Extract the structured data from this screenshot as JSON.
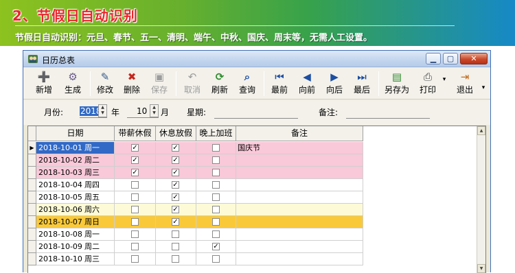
{
  "slide": {
    "title": "2、节假日自动识别",
    "subtitle": "节假日自动识别：元旦、春节、五一、清明、端午、中秋、国庆、周末等，无需人工设置。"
  },
  "window": {
    "title": "日历总表",
    "minimize_glyph": "▁",
    "maximize_glyph": "▢",
    "close_glyph": "✕"
  },
  "toolbar": {
    "new": {
      "label": "新增",
      "glyph": "➕"
    },
    "generate": {
      "label": "生成",
      "glyph": "⚙"
    },
    "edit": {
      "label": "修改",
      "glyph": "✎"
    },
    "delete": {
      "label": "删除",
      "glyph": "✖"
    },
    "save": {
      "label": "保存",
      "glyph": "▣"
    },
    "cancel": {
      "label": "取消",
      "glyph": "↶"
    },
    "refresh": {
      "label": "刷新",
      "glyph": "⟳"
    },
    "query": {
      "label": "查询",
      "glyph": "⌕"
    },
    "first": {
      "label": "最前",
      "glyph": "⏮"
    },
    "prev": {
      "label": "向前",
      "glyph": "◀"
    },
    "next": {
      "label": "向后",
      "glyph": "▶"
    },
    "last": {
      "label": "最后",
      "glyph": "⏭"
    },
    "save_as": {
      "label": "另存为",
      "glyph": "▤"
    },
    "print": {
      "label": "打印",
      "glyph": "⎙"
    },
    "print_dropdown_glyph": "▾",
    "exit": {
      "label": "退出",
      "glyph": "⇥"
    },
    "overflow_glyph": "▾"
  },
  "filter": {
    "month_label": "月份:",
    "year_value": "2018",
    "year_unit": "年",
    "month_value": "10",
    "month_unit": "月",
    "weekday_label": "星期:",
    "remark_label": "备注:",
    "spin_up": "▲",
    "spin_down": "▼"
  },
  "grid": {
    "columns": {
      "date": "日期",
      "paid_leave": "带薪休假",
      "holiday": "休息放假",
      "night_shift": "晚上加班",
      "remark": "备注"
    },
    "current_row_glyph": "▶",
    "check_glyph": "✓",
    "rows": [
      {
        "date": "2018-10-01",
        "weekday": "周一",
        "paid": true,
        "holiday": true,
        "night": false,
        "remark": "国庆节",
        "bg": "#f9c8d9",
        "fg": "#ffffff",
        "sel": true
      },
      {
        "date": "2018-10-02",
        "weekday": "周二",
        "paid": true,
        "holiday": true,
        "night": false,
        "remark": "",
        "bg": "#f9c8d9",
        "fg": "#000000",
        "sel": false
      },
      {
        "date": "2018-10-03",
        "weekday": "周三",
        "paid": true,
        "holiday": true,
        "night": false,
        "remark": "",
        "bg": "#f9c8d9",
        "fg": "#000000",
        "sel": false
      },
      {
        "date": "2018-10-04",
        "weekday": "周四",
        "paid": false,
        "holiday": true,
        "night": false,
        "remark": "",
        "bg": "#ffffff",
        "fg": "#000000",
        "sel": false
      },
      {
        "date": "2018-10-05",
        "weekday": "周五",
        "paid": false,
        "holiday": true,
        "night": false,
        "remark": "",
        "bg": "#ffffff",
        "fg": "#000000",
        "sel": false
      },
      {
        "date": "2018-10-06",
        "weekday": "周六",
        "paid": false,
        "holiday": true,
        "night": false,
        "remark": "",
        "bg": "#fdfbd7",
        "fg": "#000000",
        "sel": false
      },
      {
        "date": "2018-10-07",
        "weekday": "周日",
        "paid": false,
        "holiday": true,
        "night": false,
        "remark": "",
        "bg": "#f9c93a",
        "fg": "#000000",
        "sel": false
      },
      {
        "date": "2018-10-08",
        "weekday": "周一",
        "paid": false,
        "holiday": false,
        "night": false,
        "remark": "",
        "bg": "#ffffff",
        "fg": "#000000",
        "sel": false
      },
      {
        "date": "2018-10-09",
        "weekday": "周二",
        "paid": false,
        "holiday": false,
        "night": true,
        "remark": "",
        "bg": "#ffffff",
        "fg": "#000000",
        "sel": false
      },
      {
        "date": "2018-10-10",
        "weekday": "周三",
        "paid": false,
        "holiday": false,
        "night": false,
        "remark": "",
        "bg": "#ffffff",
        "fg": "#000000",
        "sel": false
      }
    ]
  },
  "scrollbar": {
    "up_glyph": "▲",
    "down_glyph": "▼"
  },
  "colors": {
    "selected_date_bg": "#3169c6",
    "holiday_pink": "#f9c8d9",
    "saturday_yellow": "#fdfbd7",
    "sunday_orange": "#f9c93a"
  }
}
